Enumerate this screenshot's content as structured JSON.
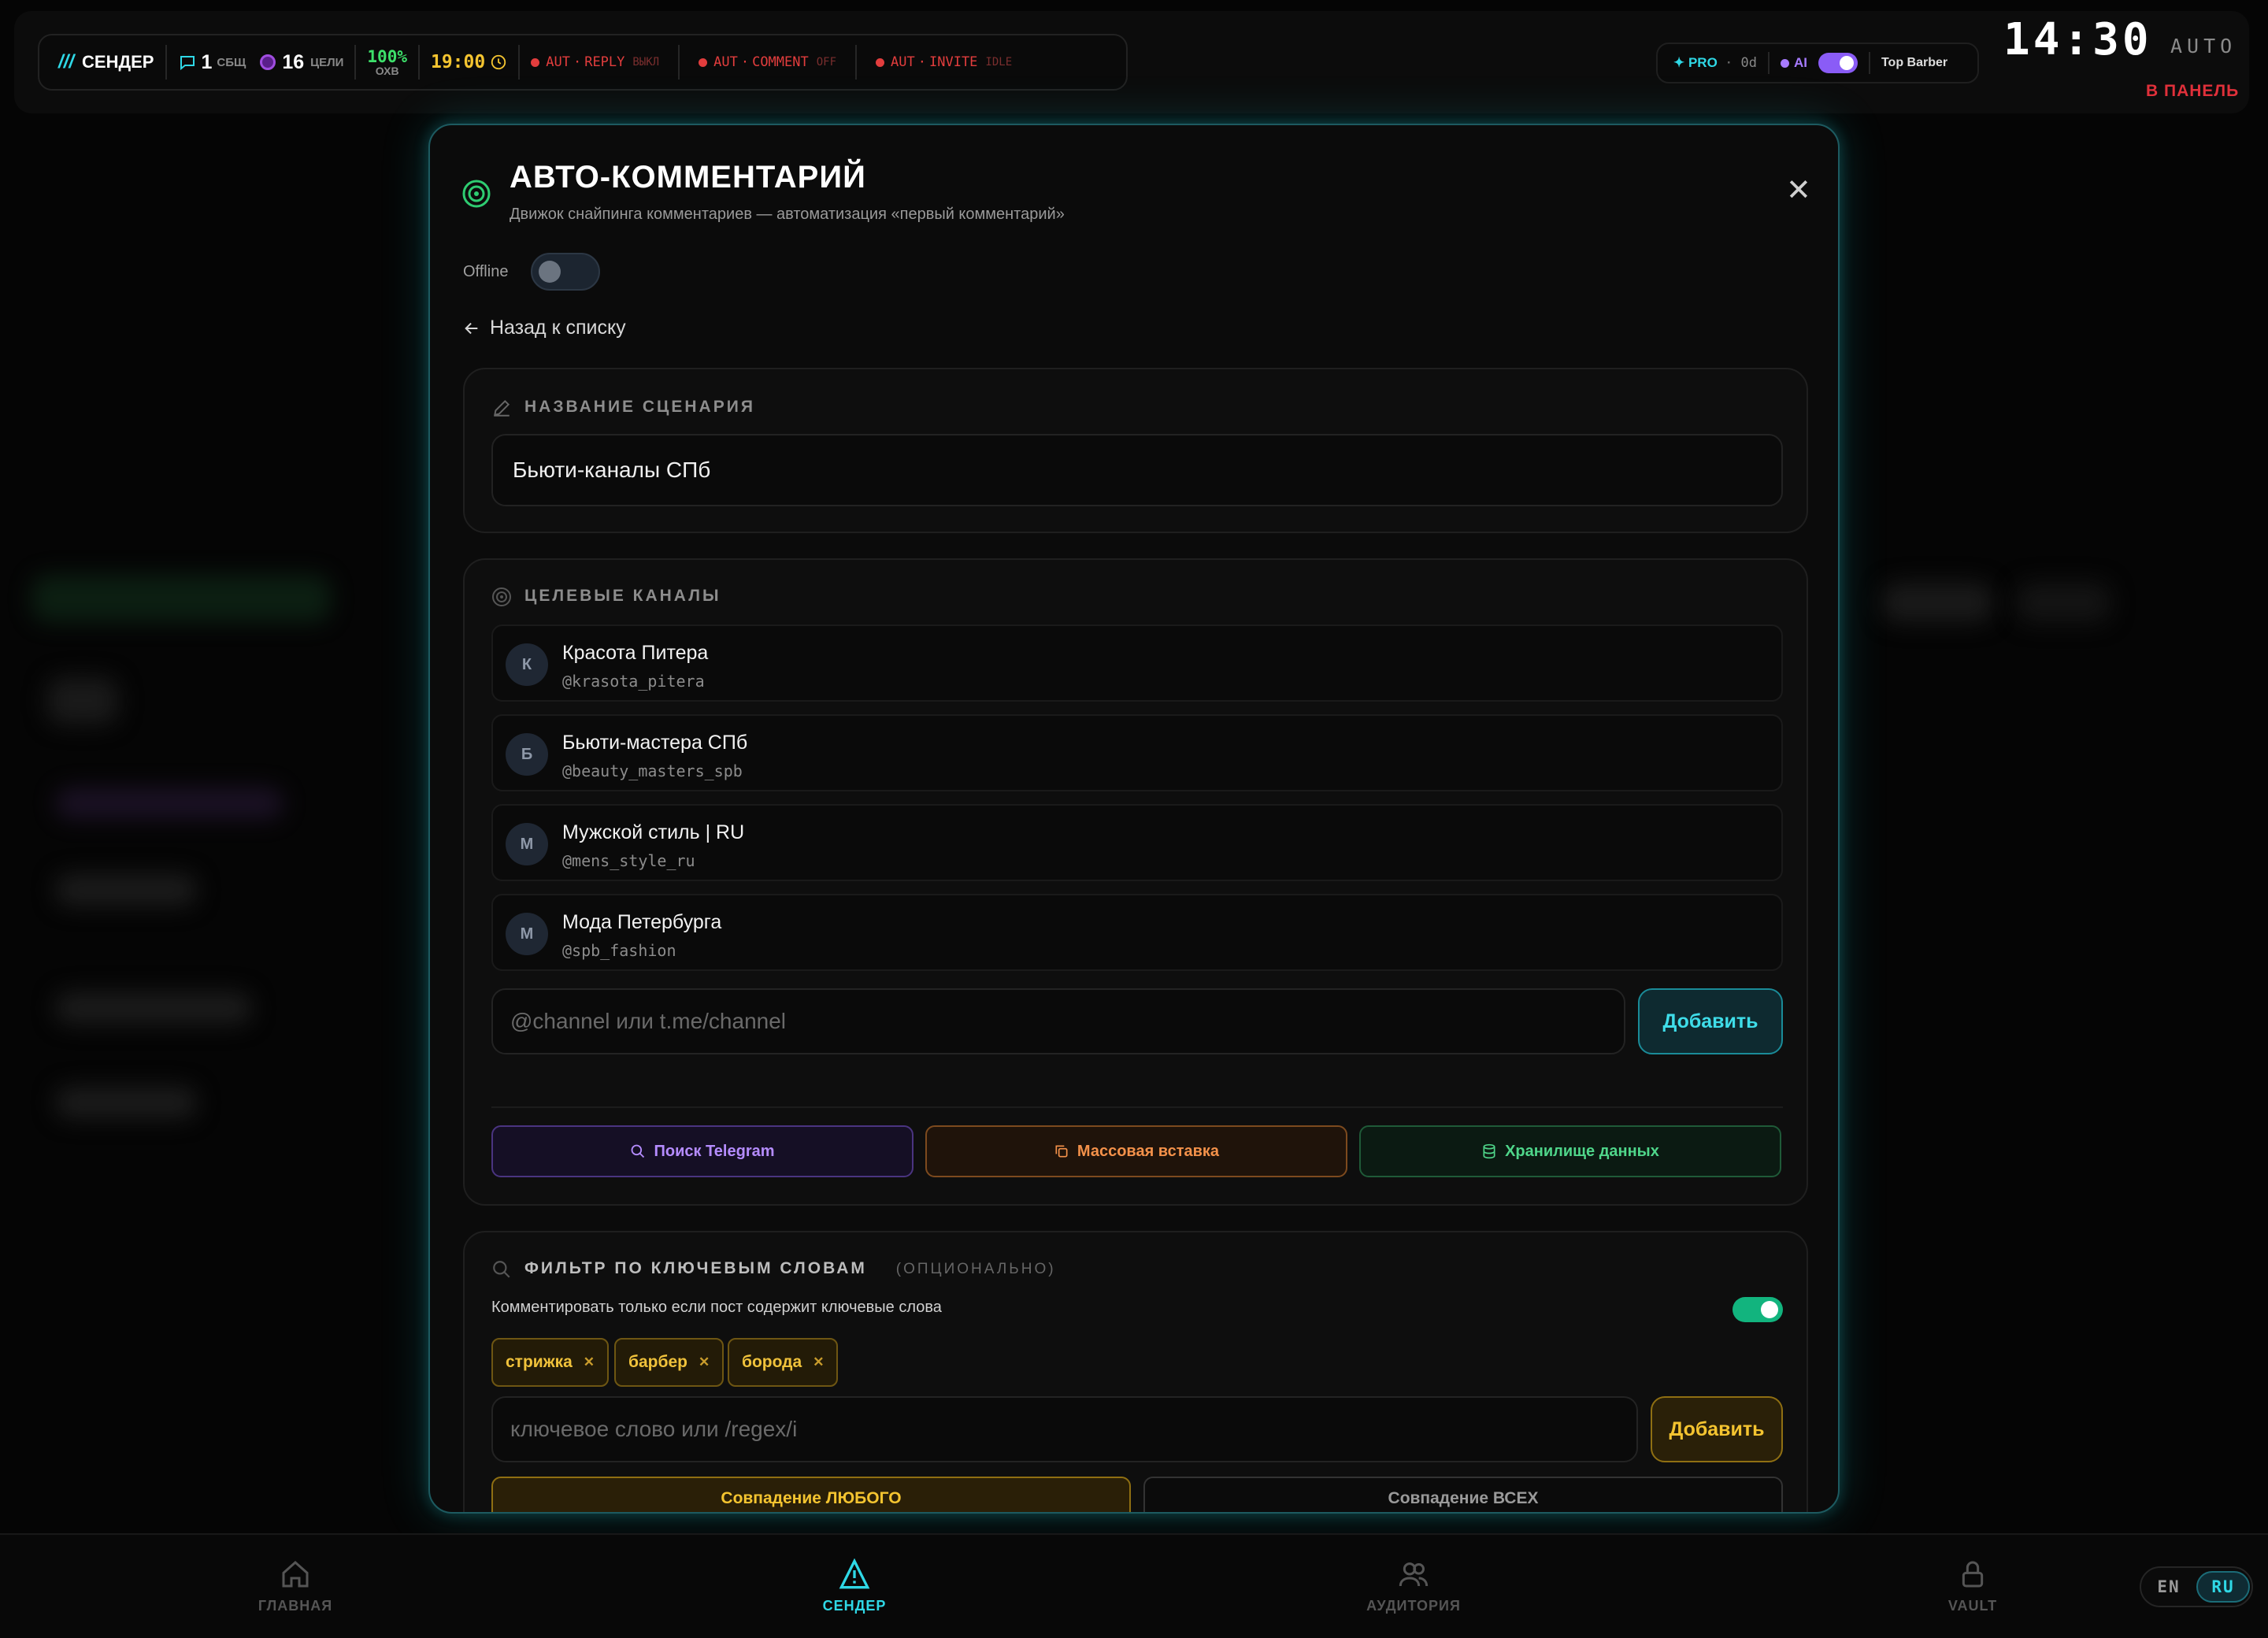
{
  "status_bar": {
    "brand_slashes": "///",
    "brand": "СЕНДЕР",
    "messages_count": "1",
    "messages_label": "СБЩ",
    "targets_count": "16",
    "targets_label": "ЦЕЛИ",
    "coverage_value": "100%",
    "coverage_label": "ОХВ",
    "time": "19:00",
    "auto_reply": {
      "prefix": "AUT",
      "name": "REPLY",
      "state": "ВЫКЛ"
    },
    "auto_comment": {
      "prefix": "AUT",
      "name": "COMMENT",
      "state": "OFF"
    },
    "auto_invite": {
      "prefix": "AUT",
      "name": "INVITE",
      "state": "IDLE"
    }
  },
  "account_pill": {
    "plan": "✦ PRO",
    "sep": "·",
    "days": "0d",
    "ai_label": "AI",
    "account": "Top Barber"
  },
  "clock": "14:30",
  "mode": "AUTO",
  "panel_link": "В ПАНЕЛЬ",
  "modal": {
    "title": "АВТО-КОММЕНТАРИЙ",
    "subtitle": "Движок снайпинга комментариев — автоматизация «первый комментарий»",
    "offline_label": "Offline",
    "back_label": "Назад к списку",
    "name_section": {
      "label": "НАЗВАНИЕ СЦЕНАРИЯ",
      "value": "Бьюти-каналы СПб"
    },
    "channels_section": {
      "label": "ЦЕЛЕВЫЕ КАНАЛЫ",
      "channels": [
        {
          "initial": "К",
          "name": "Красота Питера",
          "handle": "@krasota_pitera"
        },
        {
          "initial": "Б",
          "name": "Бьюти-мастера СПб",
          "handle": "@beauty_masters_spb"
        },
        {
          "initial": "М",
          "name": "Мужской стиль | RU",
          "handle": "@mens_style_ru"
        },
        {
          "initial": "М",
          "name": "Мода Петербурга",
          "handle": "@spb_fashion"
        }
      ],
      "input_placeholder": "@channel или t.me/channel",
      "add_button": "Добавить",
      "tools": {
        "search": "Поиск Telegram",
        "bulk": "Массовая вставка",
        "storage": "Хранилище данных"
      }
    },
    "keywords_section": {
      "label": "ФИЛЬТР ПО КЛЮЧЕВЫМ СЛОВАМ",
      "optional": "(ОПЦИОНАЛЬНО)",
      "description": "Комментировать только если пост содержит ключевые слова",
      "enabled": true,
      "keywords": [
        "стрижка",
        "барбер",
        "борода"
      ],
      "input_placeholder": "ключевое слово или /regex/i",
      "add_button": "Добавить",
      "match_any": "Совпадение ЛЮБОГО",
      "match_all": "Совпадение ВСЕХ"
    }
  },
  "bottom_nav": {
    "home": "ГЛАВНАЯ",
    "sender": "СЕНДЕР",
    "audience": "АУДИТОРИЯ",
    "vault": "VAULT"
  },
  "language": {
    "en": "EN",
    "ru": "RU",
    "selected": "RU"
  },
  "colors": {
    "accent": "#2fd8e6",
    "keyword": "#f4c430",
    "success": "#12b47e",
    "danger": "#e0303a"
  }
}
